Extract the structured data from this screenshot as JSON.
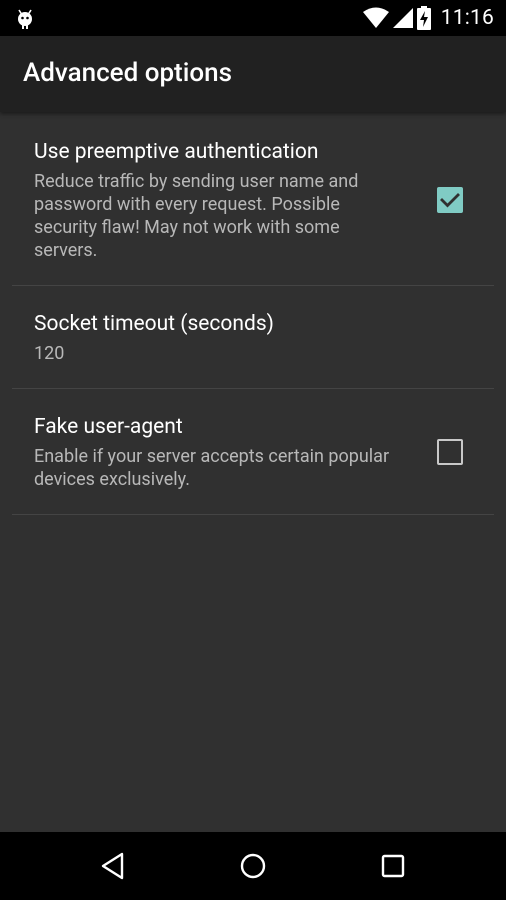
{
  "status_bar": {
    "time": "11:16",
    "icons": [
      "android-debug-icon",
      "wifi-icon",
      "cell-signal-icon",
      "battery-charging-icon"
    ]
  },
  "toolbar": {
    "title": "Advanced options"
  },
  "preferences": [
    {
      "title": "Use preemptive authentication",
      "summary": "Reduce traffic by sending user name and password with every request. Possible security flaw! May not work with some servers.",
      "checked": true
    },
    {
      "title": "Socket timeout (seconds)",
      "summary": "120"
    },
    {
      "title": "Fake user-agent",
      "summary": "Enable if your server accepts certain popular devices exclusively.",
      "checked": false
    }
  ],
  "colors": {
    "background": "#303030",
    "toolbar": "#212121",
    "accent": "#80cbc4"
  },
  "nav_bar": {
    "buttons": [
      "back-icon",
      "home-icon",
      "recents-icon"
    ]
  }
}
